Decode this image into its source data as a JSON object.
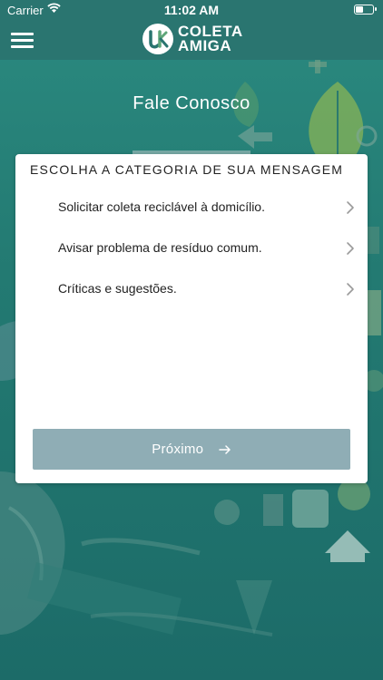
{
  "status_bar": {
    "carrier": "Carrier",
    "time": "11:02 AM"
  },
  "nav": {
    "logo_line1": "COLETA",
    "logo_line2": "AMIGA"
  },
  "page_title": "Fale Conosco",
  "card": {
    "heading": "ESCOLHA A CATEGORIA DE SUA MENSAGEM",
    "options": [
      {
        "label": "Solicitar coleta reciclável à domicílio."
      },
      {
        "label": "Avisar problema de resíduo comum."
      },
      {
        "label": "Críticas e sugestões."
      }
    ],
    "next_button": "Próximo"
  },
  "colors": {
    "header": "#2a7570",
    "background": "#237a72",
    "button": "#8fadb5"
  }
}
